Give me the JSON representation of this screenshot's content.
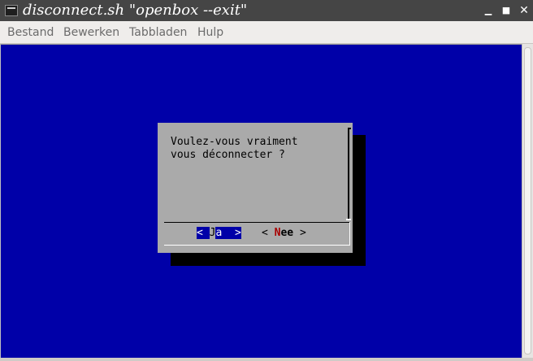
{
  "window": {
    "title": "disconnect.sh \"openbox --exit\"",
    "controls": {
      "minimize": "▁",
      "maximize": "■",
      "close": "✕"
    }
  },
  "menu": {
    "items": [
      {
        "label": "Bestand"
      },
      {
        "label": "Bewerken"
      },
      {
        "label": "Tabbladen"
      },
      {
        "label": "Hulp"
      }
    ]
  },
  "dialog": {
    "message": "Voulez-vous vraiment\nvous déconnecter ?",
    "yes": {
      "open": "< ",
      "hotkey": "J",
      "rest": "a ",
      "close": " >"
    },
    "no": {
      "open": "< ",
      "hotkey": "N",
      "rest": "ee",
      "close": " >"
    }
  },
  "colors": {
    "terminal_bg": "#0000a8",
    "dialog_bg": "#aaaaaa",
    "hotkey": "#a80000"
  }
}
